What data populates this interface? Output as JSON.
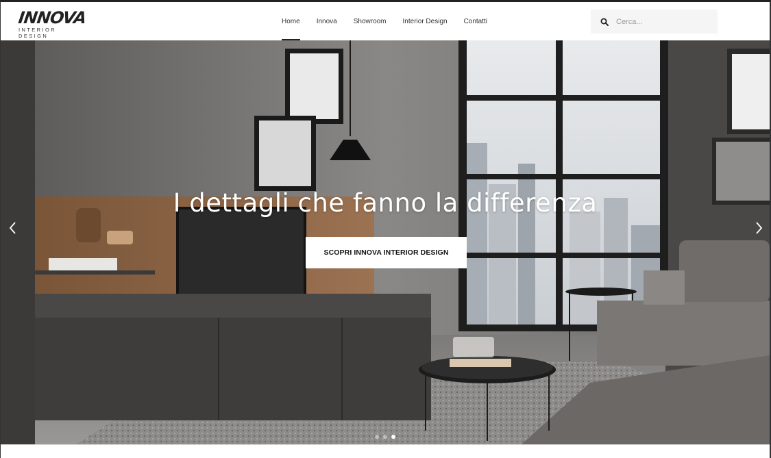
{
  "brand": {
    "logo_text": "INNOVA",
    "logo_subtitle": "INTERIOR DESIGN"
  },
  "nav": {
    "items": [
      {
        "label": "Home",
        "active": true
      },
      {
        "label": "Innova",
        "active": false
      },
      {
        "label": "Showroom",
        "active": false
      },
      {
        "label": "Interior Design",
        "active": false
      },
      {
        "label": "Contatti",
        "active": false
      }
    ]
  },
  "search": {
    "placeholder": "Cerca...",
    "icon": "search-icon"
  },
  "hero": {
    "title": "I dettagli che fanno la differenza",
    "cta_label": "SCOPRI INNOVA INTERIOR DESIGN",
    "prev_icon": "chevron-left-icon",
    "next_icon": "chevron-right-icon",
    "slides": 3,
    "active_slide": 3
  },
  "colors": {
    "accent": "#222222",
    "hero_text": "#ffffff",
    "search_bg": "#f5f5f5"
  }
}
